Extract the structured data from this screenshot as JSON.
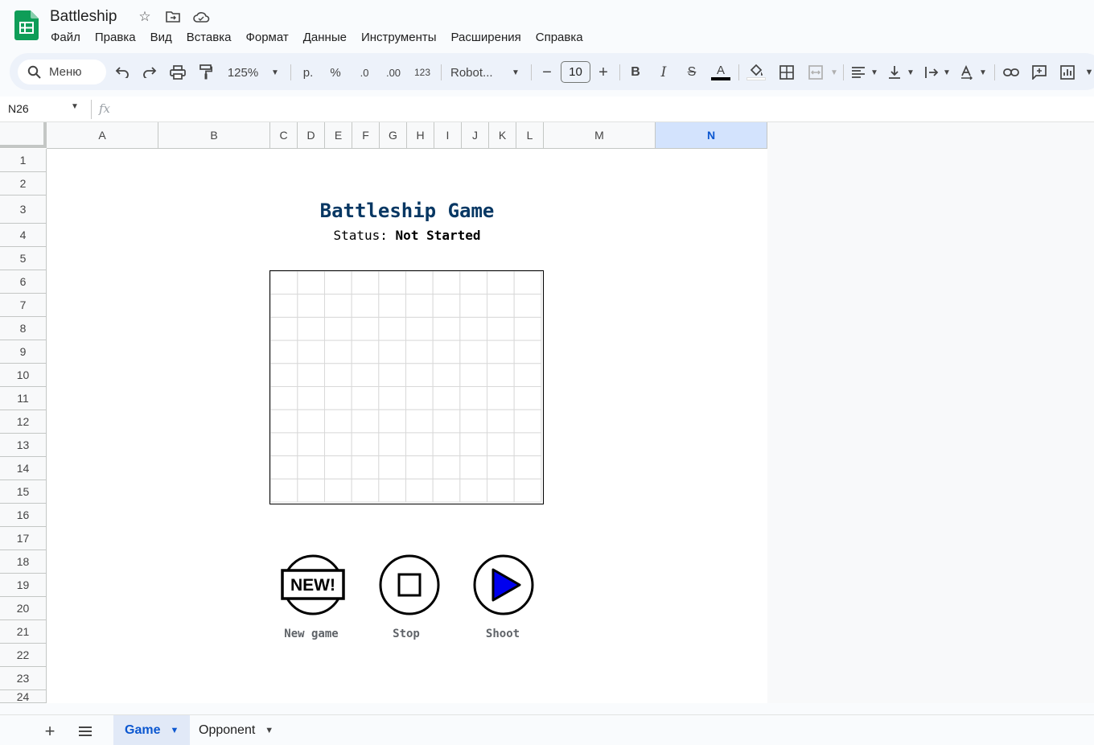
{
  "app": {
    "doc_title": "Battleship",
    "menu": [
      "Файл",
      "Правка",
      "Вид",
      "Вставка",
      "Формат",
      "Данные",
      "Инструменты",
      "Расширения",
      "Справка"
    ]
  },
  "toolbar": {
    "search_label": "Меню",
    "zoom": "125%",
    "currency": "р.",
    "percent": "%",
    "decrease_decimal": ".0",
    "increase_decimal": ".00",
    "number_format": "123",
    "font": "Robot...",
    "font_size": "10",
    "minus": "−",
    "plus": "+",
    "bold": "B",
    "italic": "I",
    "strike": "S",
    "text_color": "A"
  },
  "formula_bar": {
    "cell_ref": "N26",
    "fx": "fx"
  },
  "columns": [
    "A",
    "B",
    "C",
    "D",
    "E",
    "F",
    "G",
    "H",
    "I",
    "J",
    "K",
    "L",
    "M",
    "N"
  ],
  "selected_column": "N",
  "rows": [
    "1",
    "2",
    "3",
    "4",
    "5",
    "6",
    "7",
    "8",
    "9",
    "10",
    "11",
    "12",
    "13",
    "14",
    "15",
    "16",
    "17",
    "18",
    "19",
    "20",
    "21",
    "22",
    "23",
    "24"
  ],
  "game": {
    "title": "Battleship Game",
    "status_label": "Status: ",
    "status_value": "Not Started",
    "board_size": 10,
    "buttons": {
      "new_game_label": "New game",
      "new_badge": "NEW!",
      "stop_label": "Stop",
      "shoot_label": "Shoot"
    },
    "colors": {
      "title": "#073763",
      "shoot_triangle": "#0000ee"
    }
  },
  "sheets": {
    "tabs": [
      "Game",
      "Opponent"
    ],
    "active": "Game"
  }
}
